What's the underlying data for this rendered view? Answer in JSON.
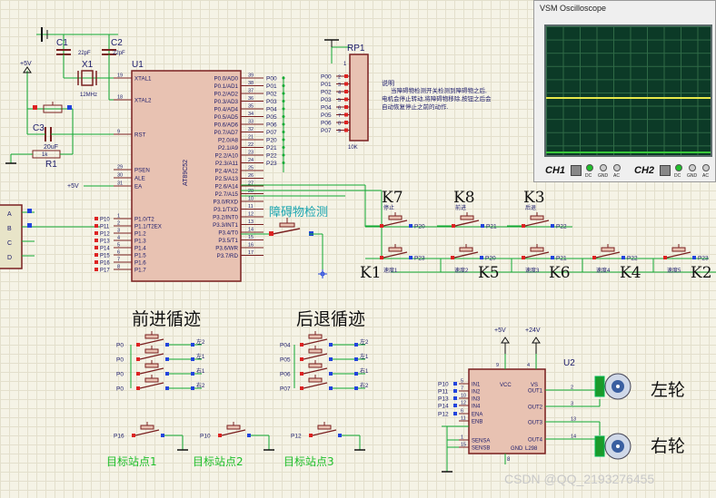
{
  "oscilloscope": {
    "title": "VSM Oscilloscope",
    "ch1": "CH1",
    "ch2": "CH2",
    "modes": [
      "DC",
      "GND",
      "AC"
    ]
  },
  "mcu": {
    "ref": "U1",
    "part": "AT89C52",
    "left_pins": [
      {
        "name": "XTAL1",
        "num": "19"
      },
      {
        "name": "XTAL2",
        "num": "18"
      },
      {
        "name": "RST",
        "num": "9"
      },
      {
        "name": "PSEN",
        "num": "29"
      },
      {
        "name": "ALE",
        "num": "30"
      },
      {
        "name": "EA",
        "num": "31"
      },
      {
        "name": "P1.0/T2",
        "num": "1"
      },
      {
        "name": "P1.1/T2EX",
        "num": "2"
      },
      {
        "name": "P1.2",
        "num": "3"
      },
      {
        "name": "P1.3",
        "num": "4"
      },
      {
        "name": "P1.4",
        "num": "5"
      },
      {
        "name": "P1.5",
        "num": "6"
      },
      {
        "name": "P1.6",
        "num": "7"
      },
      {
        "name": "P1.7",
        "num": "8"
      }
    ],
    "right_pins": [
      {
        "name": "P0.0/AD0",
        "num": "39",
        "net": "P00"
      },
      {
        "name": "P0.1/AD1",
        "num": "38",
        "net": "P01"
      },
      {
        "name": "P0.2/AD2",
        "num": "37",
        "net": "P02"
      },
      {
        "name": "P0.3/AD3",
        "num": "36",
        "net": "P03"
      },
      {
        "name": "P0.4/AD4",
        "num": "35",
        "net": "P04"
      },
      {
        "name": "P0.5/AD5",
        "num": "34",
        "net": "P05"
      },
      {
        "name": "P0.6/AD6",
        "num": "33",
        "net": "P06"
      },
      {
        "name": "P0.7/AD7",
        "num": "32",
        "net": "P07"
      },
      {
        "name": "P2.0/A8",
        "num": "21",
        "net": "P20"
      },
      {
        "name": "P2.1/A9",
        "num": "22",
        "net": "P21"
      },
      {
        "name": "P2.2/A10",
        "num": "23",
        "net": "P22"
      },
      {
        "name": "P2.3/A11",
        "num": "24",
        "net": "P23"
      },
      {
        "name": "P2.4/A12",
        "num": "25",
        "net": ""
      },
      {
        "name": "P2.5/A13",
        "num": "26",
        "net": ""
      },
      {
        "name": "P2.6/A14",
        "num": "27",
        "net": ""
      },
      {
        "name": "P2.7/A15",
        "num": "28",
        "net": ""
      },
      {
        "name": "P3.0/RXD",
        "num": "10",
        "net": ""
      },
      {
        "name": "P3.1/TXD",
        "num": "11",
        "net": ""
      },
      {
        "name": "P3.2/INT0",
        "num": "12",
        "net": ""
      },
      {
        "name": "P3.3/INT1",
        "num": "13",
        "net": ""
      },
      {
        "name": "P3.4/T0",
        "num": "14",
        "net": ""
      },
      {
        "name": "P3.5/T1",
        "num": "15",
        "net": ""
      },
      {
        "name": "P3.6/WR",
        "num": "16",
        "net": ""
      },
      {
        "name": "P3.7/RD",
        "num": "17",
        "net": ""
      }
    ],
    "p1_nets": [
      "P10",
      "P11",
      "P12",
      "P13",
      "P14",
      "P15",
      "P16",
      "P17"
    ]
  },
  "crystal": {
    "c1": "C1",
    "c2": "C2",
    "cap": "22pF",
    "x1": "X1",
    "freq": "12MHz"
  },
  "reset": {
    "c3": "C3",
    "cap": "20uF",
    "r1": "R1",
    "res": "1k"
  },
  "power": {
    "p5v": "+5V",
    "p24v": "+24V"
  },
  "rp1": {
    "ref": "RP1",
    "value": "10K",
    "nets": [
      "P00",
      "P01",
      "P02",
      "P03",
      "P04",
      "P05",
      "P06",
      "P07"
    ],
    "pins": [
      "2",
      "3",
      "4",
      "5",
      "6",
      "7",
      "8",
      "9"
    ],
    "pin1": "1"
  },
  "note": {
    "title": "说明",
    "lines": [
      "当障碍物检测开关检测到障碍物之后,",
      "电机会停止转动,将障碍物移除,按钮之后会",
      "自动恢复停止之前的动作."
    ]
  },
  "obstacle_label": "障碍物检测",
  "keys_top": [
    {
      "label": "K7",
      "sub": "停止",
      "net": "P20"
    },
    {
      "label": "K8",
      "sub": "前进",
      "net": "P21"
    },
    {
      "label": "K3",
      "sub": "后退",
      "net": "P22"
    }
  ],
  "keys_bottom": [
    {
      "label": "K1",
      "sub": "速度1",
      "net": "P23"
    },
    {
      "label": "K5",
      "sub": "速度2",
      "net": "P20"
    },
    {
      "label": "K6",
      "sub": "速度3",
      "net": "P21"
    },
    {
      "label": "K4",
      "sub": "速度4",
      "net": "P22"
    },
    {
      "label": "K2",
      "sub": "速度5",
      "net": "P23"
    }
  ],
  "forward": {
    "title": "前进循迹",
    "nets": [
      "P0",
      "P0",
      "P0",
      "P0"
    ],
    "labels": [
      "左2",
      "左1",
      "右1",
      "右2"
    ]
  },
  "backward": {
    "title": "后退循迹",
    "nets": [
      "P04",
      "P05",
      "P06",
      "P07"
    ],
    "labels": [
      "左2",
      "左1",
      "右1",
      "右2"
    ]
  },
  "targets": [
    {
      "net": "P16",
      "label": "目标站点1"
    },
    {
      "net": "P10",
      "label": "目标站点2"
    },
    {
      "net": "P12",
      "label": "目标站点3"
    }
  ],
  "l298": {
    "ref": "U2",
    "part": "L298",
    "left": [
      {
        "n": "IN1",
        "pin": "5",
        "net": "P10"
      },
      {
        "n": "IN2",
        "pin": "7",
        "net": "P11"
      },
      {
        "n": "IN3",
        "pin": "10",
        "net": "P13"
      },
      {
        "n": "IN4",
        "pin": "12",
        "net": "P14"
      },
      {
        "n": "ENA",
        "pin": "6",
        "net": "P12"
      },
      {
        "n": "ENB",
        "pin": "11",
        "net": ""
      },
      {
        "n": "SENSA",
        "pin": "1",
        "net": ""
      },
      {
        "n": "SENSB",
        "pin": "15",
        "net": ""
      }
    ],
    "top": [
      {
        "n": "VCC",
        "pin": "9"
      },
      {
        "n": "VS",
        "pin": "4"
      }
    ],
    "right": [
      {
        "n": "OUT1",
        "pin": "2"
      },
      {
        "n": "OUT2",
        "pin": "3"
      },
      {
        "n": "OUT3",
        "pin": "13"
      },
      {
        "n": "OUT4",
        "pin": "14"
      }
    ],
    "gnd": "GND",
    "gnd_pin": "8"
  },
  "motors": [
    {
      "label": "左轮"
    },
    {
      "label": "右轮"
    }
  ],
  "watermark": "CSDN @QQ_2193276455"
}
